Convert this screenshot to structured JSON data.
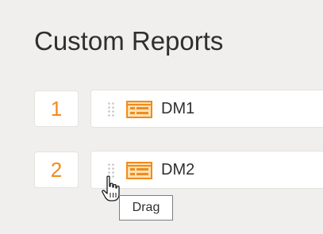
{
  "page": {
    "title": "Custom Reports"
  },
  "reports": [
    {
      "number": "1",
      "name": "DM1"
    },
    {
      "number": "2",
      "name": "DM2"
    }
  ],
  "tooltip": {
    "text": "Drag"
  },
  "colors": {
    "accent": "#f28a1c",
    "background": "#f0efed",
    "icon_fill": "#fbe2b4"
  },
  "icons": {
    "drag": "drag-handle-icon",
    "report": "report-icon",
    "cursor": "hand-pointer-icon"
  }
}
